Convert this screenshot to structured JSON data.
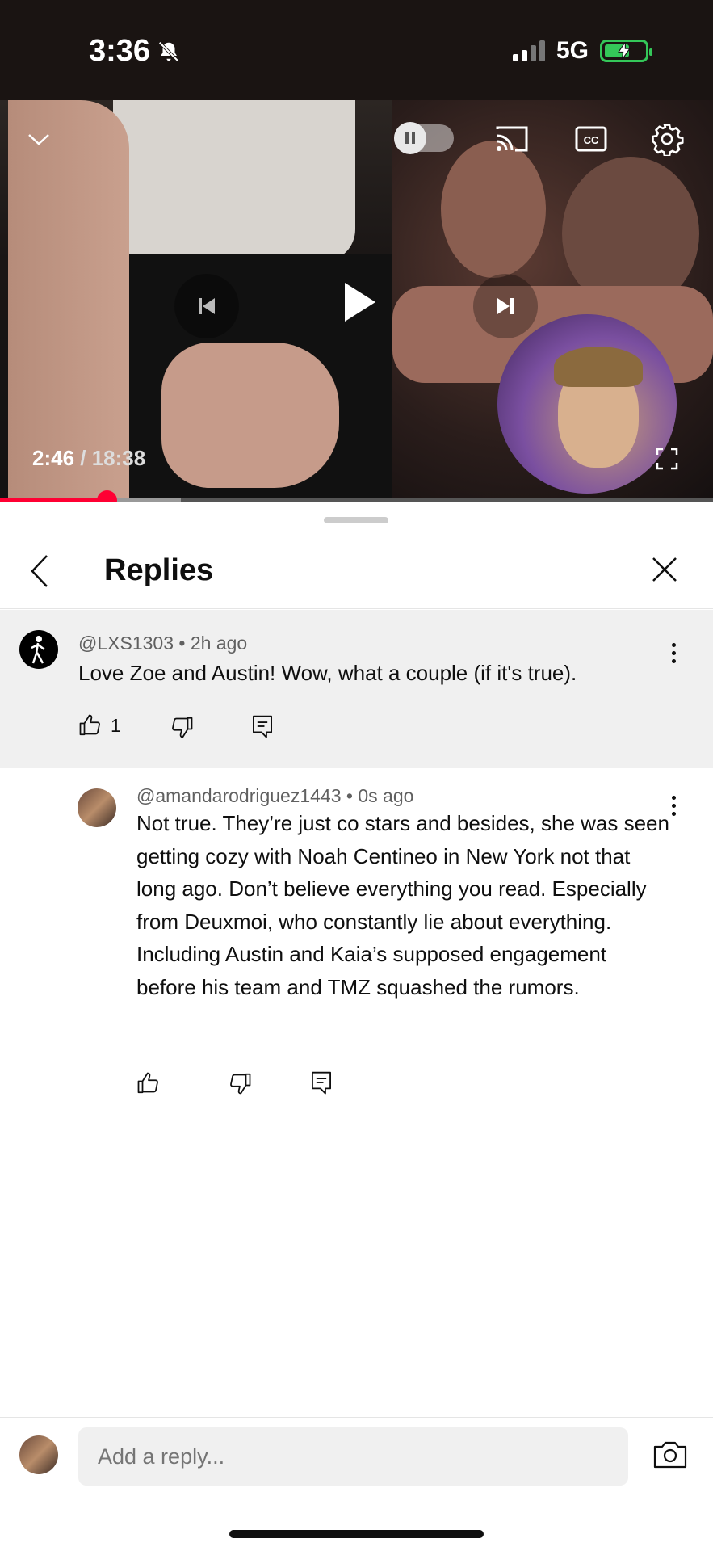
{
  "status_bar": {
    "time": "3:36",
    "network": "5G"
  },
  "video": {
    "current_time": "2:46",
    "separator": " / ",
    "total_time": "18:38",
    "progress_fraction": 0.149,
    "buffer_fraction": 0.254,
    "progress_color": "#ff0033"
  },
  "sheet": {
    "title": "Replies"
  },
  "parent_comment": {
    "author": "@LXS1303",
    "time": "2h ago",
    "text": "Love Zoe and Austin! Wow, what a couple (if it's true).",
    "like_count": "1"
  },
  "reply": {
    "author": "@amandarodriguez1443",
    "time": "0s ago",
    "text": "Not true. They’re just co stars and besides, she was seen getting cozy with Noah Centineo in New York not that long ago. Don’t believe everything you read. Especially from Deuxmoi, who constantly lie about everything. Including Austin and Kaia’s supposed engagement before his team and TMZ squashed the rumors."
  },
  "reply_bar": {
    "placeholder": "Add a reply..."
  },
  "icons": {
    "collapse": "chevron-down-icon",
    "autoplay": "autoplay-toggle",
    "cast": "cast-icon",
    "captions": "cc-icon",
    "settings": "gear-icon",
    "previous": "skip-previous-icon",
    "play": "play-icon",
    "next": "skip-next-icon",
    "fullscreen": "fullscreen-icon",
    "back": "chevron-left-icon",
    "close": "close-icon",
    "like": "thumbs-up-icon",
    "dislike": "thumbs-down-icon",
    "reply": "comment-icon",
    "more": "more-vertical-icon",
    "camera": "camera-icon"
  }
}
